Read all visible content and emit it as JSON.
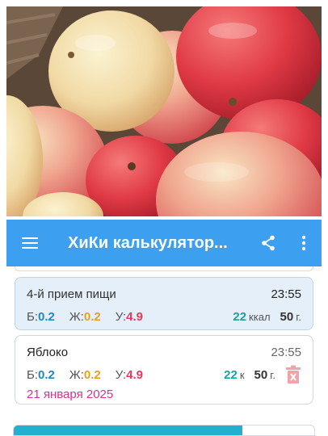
{
  "header": {
    "title": "ХиКи калькулятор...",
    "accent_color": "#3d9ff0",
    "menu_icon": "hamburger-menu-icon",
    "share_icon": "share-icon",
    "more_icon": "more-vert-icon"
  },
  "image": {
    "description": "apples"
  },
  "meal_card": {
    "title": "4-й прием пищи",
    "time": "23:55",
    "protein_label": "Б:",
    "protein_value": "0.2",
    "fat_label": "Ж:",
    "fat_value": "0.2",
    "carbs_label": "У:",
    "carbs_value": "4.9",
    "kcal_value": "22",
    "kcal_unit": "ккал",
    "weight_value": "50",
    "weight_unit": "г."
  },
  "food_card": {
    "title": "Яблоко",
    "time": "23:55",
    "protein_label": "Б:",
    "protein_value": "0.2",
    "fat_label": "Ж:",
    "fat_value": "0.2",
    "carbs_label": "У:",
    "carbs_value": "4.9",
    "kcal_value": "22",
    "kcal_unit": "к",
    "weight_value": "50",
    "weight_unit": "г.",
    "date": "21 января 2025",
    "delete_icon": "delete-icon"
  },
  "colors": {
    "protein": "#1f86c8",
    "fat": "#e8a313",
    "carbs": "#e53960",
    "kcal": "#1aa39c",
    "date": "#d6338a"
  },
  "bottom_bar": {
    "fill_fraction": 0.76
  }
}
